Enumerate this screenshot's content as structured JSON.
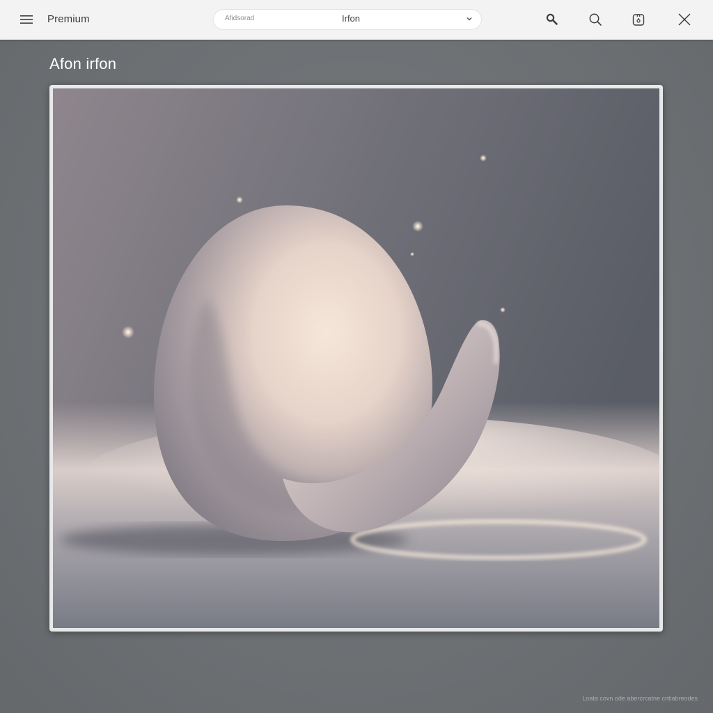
{
  "topbar": {
    "menu_icon": "hamburger-menu-icon",
    "app_title": "Premium",
    "dropdown": {
      "left_label": "Afidsorad",
      "selected_value": "Irfon",
      "chevron_icon": "chevron-down-icon"
    },
    "actions": [
      {
        "icon": "magnify-icon"
      },
      {
        "icon": "search-icon"
      },
      {
        "icon": "lock-icon"
      },
      {
        "icon": "close-icon"
      }
    ]
  },
  "main": {
    "heading": "Afon irfon",
    "image_description_none": "",
    "footer_note": "Loata covn ode abercrcatne cntiabreodes"
  },
  "colors": {
    "topbar_bg": "#f3f3f4",
    "page_bg": "#6d7174",
    "frame_border": "#e9e9ea",
    "text_dark": "#3a3c40",
    "heading_text": "#ffffff"
  }
}
